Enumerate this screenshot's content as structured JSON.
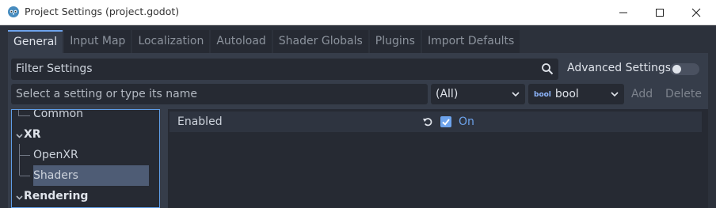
{
  "window": {
    "title": "Project Settings (project.godot)"
  },
  "tabs": [
    {
      "label": "General",
      "active": true
    },
    {
      "label": "Input Map"
    },
    {
      "label": "Localization"
    },
    {
      "label": "Autoload"
    },
    {
      "label": "Shader Globals"
    },
    {
      "label": "Plugins"
    },
    {
      "label": "Import Defaults"
    }
  ],
  "filter": {
    "placeholder": "Filter Settings",
    "advanced_label": "Advanced Settings",
    "advanced_enabled": false
  },
  "add_setting": {
    "placeholder": "Select a setting or type its name",
    "scope": "(All)",
    "type_icon": "bool",
    "type": "bool",
    "add_label": "Add",
    "delete_label": "Delete"
  },
  "tree": {
    "items": [
      {
        "label": "Common",
        "kind": "leaf"
      },
      {
        "label": "XR",
        "kind": "section"
      },
      {
        "label": "OpenXR",
        "kind": "leaf"
      },
      {
        "label": "Shaders",
        "kind": "leaf",
        "selected": true
      },
      {
        "label": "Rendering",
        "kind": "section"
      }
    ]
  },
  "inspector": {
    "property": "Enabled",
    "value_label": "On",
    "checked": true
  },
  "colors": {
    "accent": "#6da3ec",
    "background": "#363d4a",
    "field": "#262a33"
  }
}
